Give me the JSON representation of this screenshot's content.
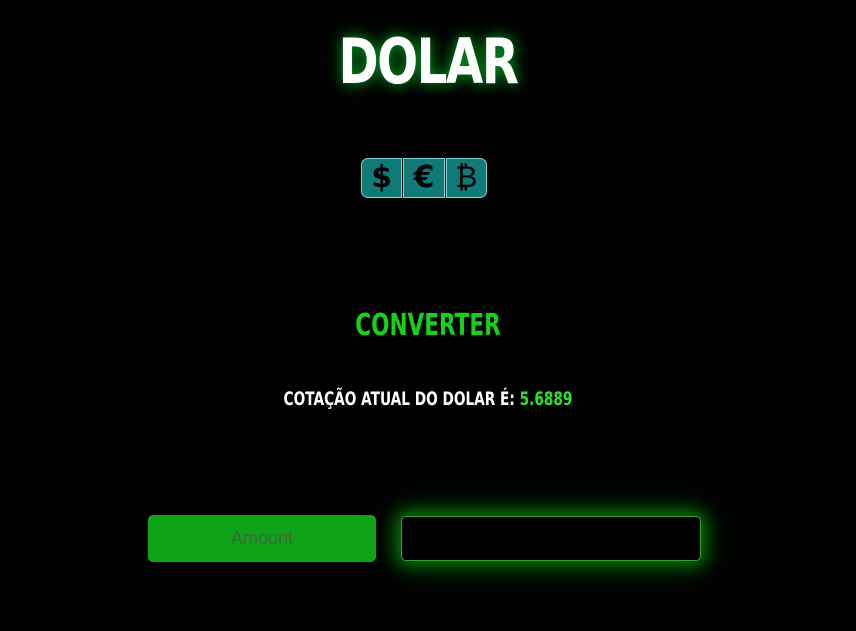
{
  "header": {
    "title": "DOLAR"
  },
  "currency_buttons": [
    {
      "symbol": "$",
      "icon": "dollar-icon"
    },
    {
      "symbol": "€",
      "icon": "euro-icon"
    },
    {
      "symbol": "₿",
      "icon": "bitcoin-icon"
    }
  ],
  "converter": {
    "heading": "CONVERTER",
    "rate_label": "COTAÇÃO ATUAL DO DOLAR É: ",
    "rate_value": "5.6889",
    "amount_placeholder": "Amount",
    "amount_value": "",
    "result_value": ""
  },
  "colors": {
    "background": "#000000",
    "accent_green": "#14d21a",
    "input_green": "#0fa31a",
    "button_teal": "#0f7a78"
  }
}
